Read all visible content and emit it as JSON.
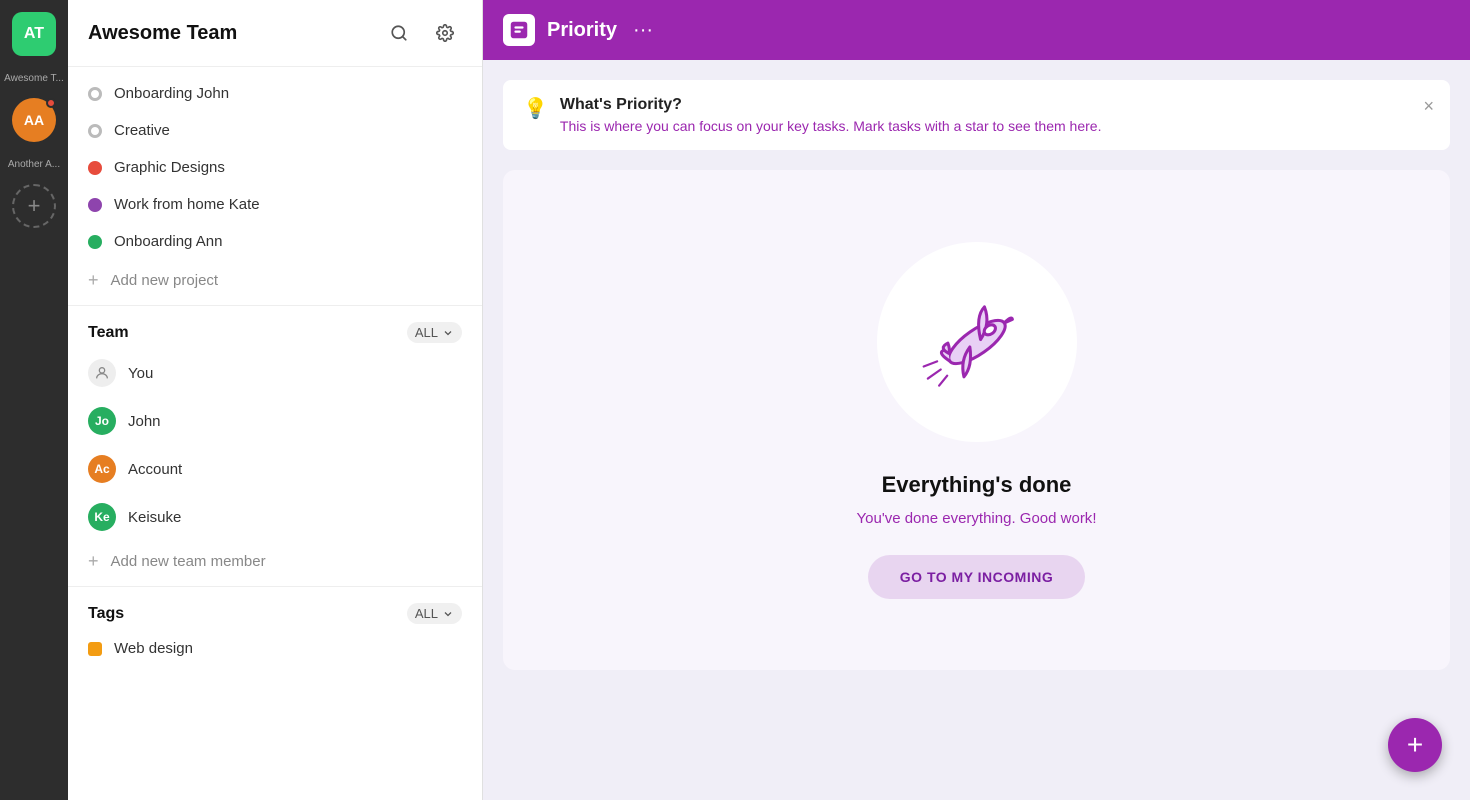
{
  "accountBar": {
    "primary": {
      "initials": "AT",
      "label": "Awesome T...",
      "bg": "#2ecc71"
    },
    "secondary": {
      "initials": "AA",
      "label": "Another A...",
      "bg": "#e67e22",
      "hasNotification": true
    },
    "addWorkspaceLabel": "+"
  },
  "sidebar": {
    "title": "Awesome Team",
    "projects": [
      {
        "name": "Onboarding John",
        "color": "#999",
        "type": "ring"
      },
      {
        "name": "Creative",
        "color": "#999",
        "type": "ring"
      },
      {
        "name": "Graphic Designs",
        "color": "#e74c3c",
        "type": "dot"
      },
      {
        "name": "Work from home Kate",
        "color": "#8e44ad",
        "type": "dot"
      },
      {
        "name": "Onboarding Ann",
        "color": "#27ae60",
        "type": "dot"
      }
    ],
    "addProject": "Add new project",
    "team": {
      "title": "Team",
      "allLabel": "ALL",
      "members": [
        {
          "name": "You",
          "initials": "you",
          "bg": "#eee",
          "isYou": true
        },
        {
          "name": "John",
          "initials": "Jo",
          "bg": "#27ae60"
        },
        {
          "name": "Account",
          "initials": "Ac",
          "bg": "#e67e22"
        },
        {
          "name": "Keisuke",
          "initials": "Ke",
          "bg": "#27ae60"
        }
      ],
      "addMember": "Add new team member"
    },
    "tags": {
      "title": "Tags",
      "allLabel": "ALL",
      "items": [
        {
          "name": "Web design",
          "color": "#f39c12"
        }
      ]
    }
  },
  "header": {
    "title": "Priority",
    "iconLabel": "priority-icon"
  },
  "infoBanner": {
    "icon": "💡",
    "title": "What's Priority?",
    "description": "This is where you can focus on your key tasks. Mark tasks with a star to see them here."
  },
  "emptyState": {
    "title": "Everything's done",
    "descriptionPart1": "You've done everything. Good work",
    "descriptionHighlight": "!",
    "buttonLabel": "GO TO MY INCOMING"
  },
  "fab": {
    "label": "+"
  }
}
